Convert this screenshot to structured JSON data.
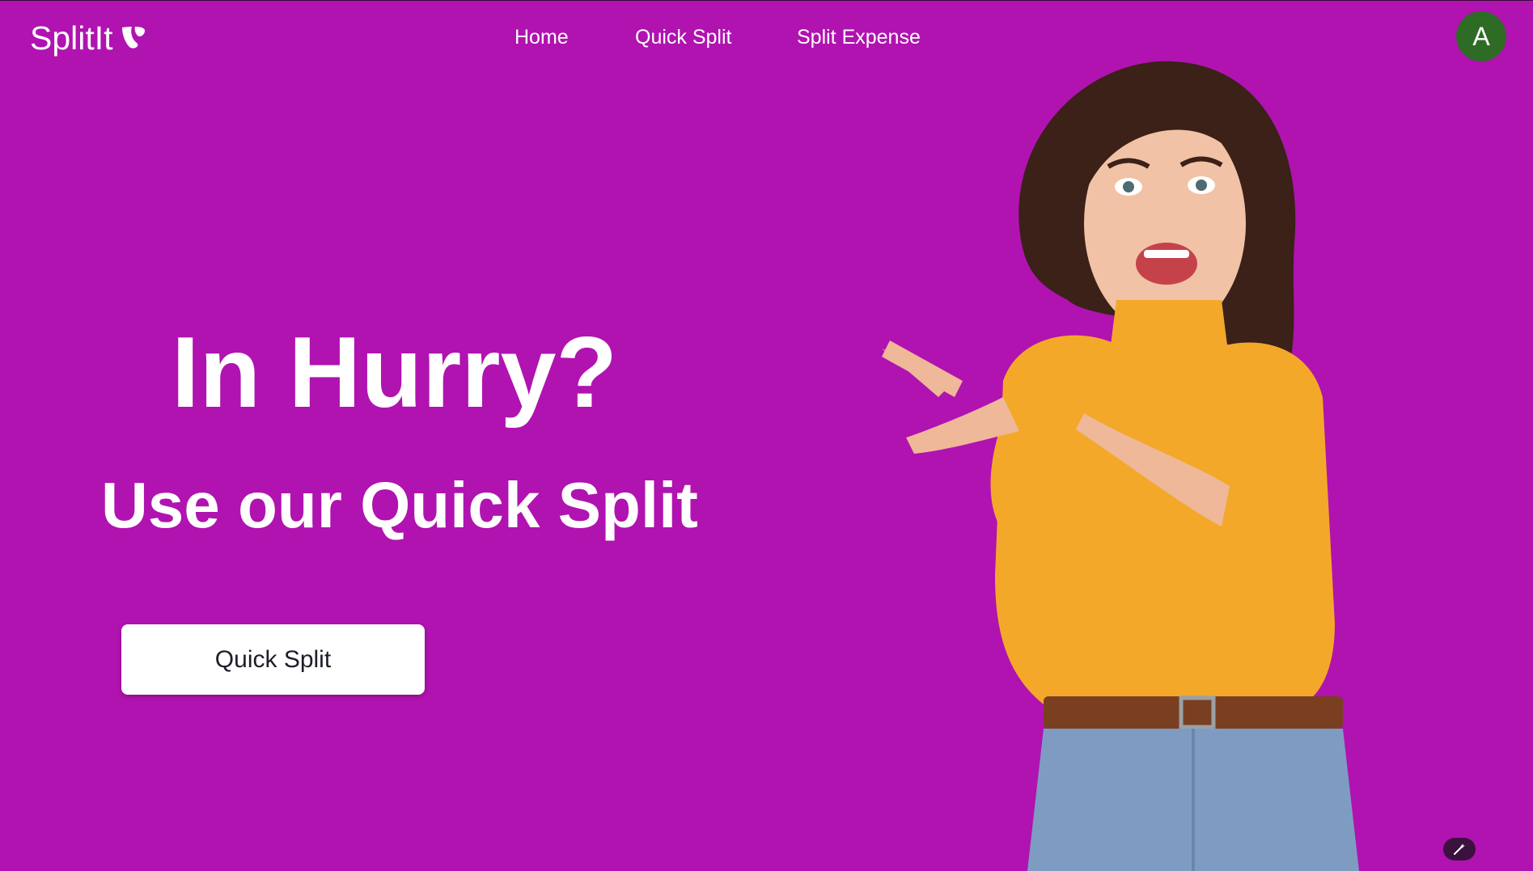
{
  "brand": {
    "name": "SplitIt",
    "logo_icon": "typo3-logo-icon"
  },
  "nav": {
    "items": [
      {
        "label": "Home"
      },
      {
        "label": "Quick Split"
      },
      {
        "label": "Split Expense"
      }
    ]
  },
  "user": {
    "avatar_initial": "A",
    "avatar_color": "#2e6b24"
  },
  "hero": {
    "title": "In Hurry?",
    "subtitle": "Use our Quick Split",
    "cta_label": "Quick Split",
    "image": "woman-pointing-left-illustration"
  },
  "corner_tool": {
    "icon": "magic-wand-icon"
  },
  "colors": {
    "background": "#b013b0",
    "text": "#ffffff",
    "button_bg": "#ffffff",
    "button_text": "#1d1d2b"
  }
}
